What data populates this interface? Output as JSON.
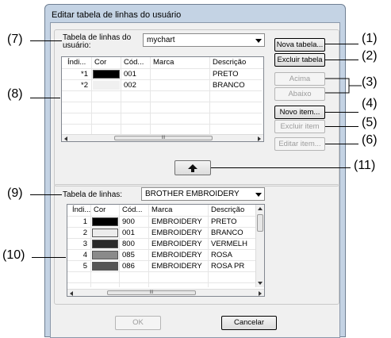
{
  "dialog": {
    "title": "Editar tabela de linhas do usuário"
  },
  "user_table": {
    "label": "Tabela de linhas do usuário:",
    "selected": "mychart",
    "columns": [
      "Índi...",
      "Cor",
      "Cód...",
      "Marca",
      "Descrição"
    ],
    "rows": [
      {
        "index": "*1",
        "color": "#000000",
        "code": "001",
        "brand": "",
        "desc": "PRETO"
      },
      {
        "index": "*2",
        "color": "#f0f0f0",
        "code": "002",
        "brand": "",
        "desc": "BRANCO"
      }
    ],
    "scroll_thumb_label": "III"
  },
  "buttons": {
    "new_table": "Nova tabela...",
    "delete_table": "Excluir tabela",
    "up": "Acima",
    "down": "Abaixo",
    "new_item": "Novo item...",
    "delete_item": "Excluir item",
    "edit_item": "Editar item...",
    "ok": "OK",
    "cancel": "Cancelar"
  },
  "thread_table": {
    "label": "Tabela de linhas:",
    "selected": "BROTHER EMBROIDERY",
    "columns": [
      "Índi...",
      "Cor",
      "Cód...",
      "Marca",
      "Descrição"
    ],
    "rows": [
      {
        "index": "1",
        "color": "#000000",
        "code": "900",
        "brand": "EMBROIDERY",
        "desc": "PRETO"
      },
      {
        "index": "2",
        "color": "#ececec",
        "code": "001",
        "brand": "EMBROIDERY",
        "desc": "BRANCO"
      },
      {
        "index": "3",
        "color": "#2a2a2a",
        "code": "800",
        "brand": "EMBROIDERY",
        "desc": "VERMELH"
      },
      {
        "index": "4",
        "color": "#8a8a8a",
        "code": "085",
        "brand": "EMBROIDERY",
        "desc": "ROSA"
      },
      {
        "index": "5",
        "color": "#555555",
        "code": "086",
        "brand": "EMBROIDERY",
        "desc": "ROSA PR"
      }
    ],
    "scroll_thumb_label": "III"
  },
  "callouts": [
    "(1)",
    "(2)",
    "(3)",
    "(4)",
    "(5)",
    "(6)",
    "(7)",
    "(8)",
    "(9)",
    "(10)",
    "(11)"
  ]
}
